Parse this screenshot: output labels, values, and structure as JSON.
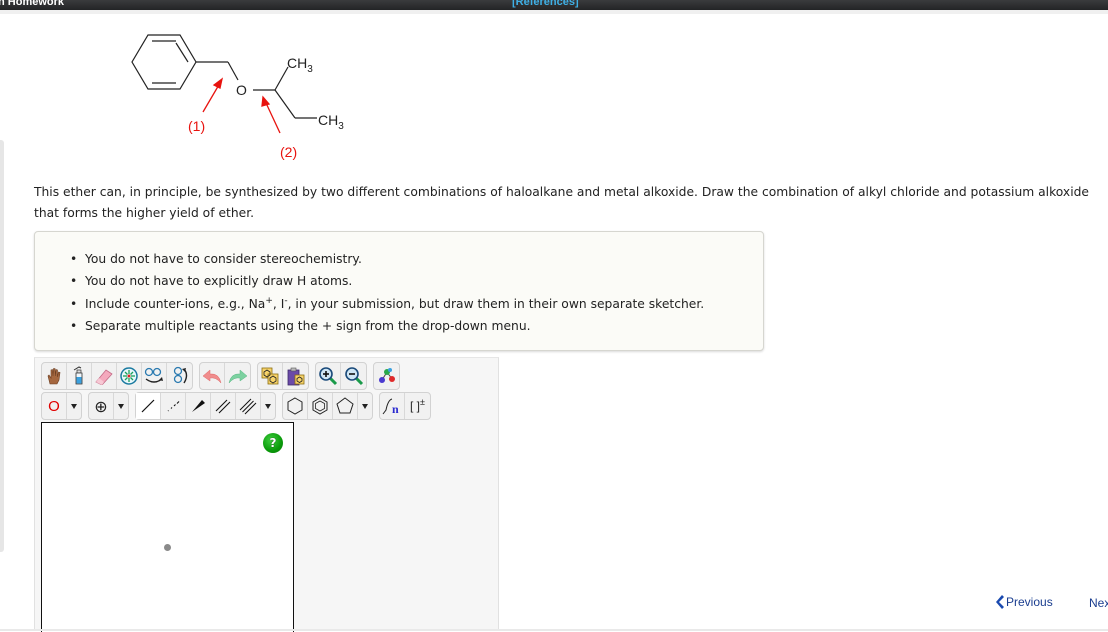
{
  "header": {
    "title": "n Homework",
    "references_link": "[References]"
  },
  "molecule": {
    "name": "benzyl sec-butyl ether",
    "oxygen_label": "O",
    "methyl_top_label": "CH",
    "methyl_bottom_label": "CH",
    "subscript": "3",
    "arrow_label_1": "(1)",
    "arrow_label_2": "(2)",
    "arrow_color": "#e8130f"
  },
  "question": {
    "text": "This ether can, in principle, be synthesized by two different combinations of haloalkane and metal alkoxide. Draw the combination of alkyl chloride and potassium alkoxide that forms the higher yield of ether."
  },
  "notes": {
    "items": [
      "You do not have to consider stereochemistry.",
      "You do not have to explicitly draw H atoms.",
      "Separate multiple reactants using the + sign from the drop-down menu."
    ],
    "counter_ion_item": {
      "prefix": "Include counter-ions, e.g., Na",
      "sup1": "+",
      "mid": ", I",
      "sup2": "-",
      "suffix": ", in your submission, but draw them in their own separate sketcher."
    }
  },
  "sketcher": {
    "toolbar_top": [
      {
        "icon": "hand-icon",
        "tooltip": "Move"
      },
      {
        "icon": "wash-bottle-icon",
        "tooltip": "Clear"
      },
      {
        "icon": "eraser-icon",
        "tooltip": "Erase"
      },
      {
        "icon": "center-icon",
        "tooltip": "Center"
      },
      {
        "icon": "flip-horizontal-icon",
        "tooltip": "Flip horizontal"
      },
      {
        "icon": "flip-vertical-icon",
        "tooltip": "Flip vertical"
      },
      {
        "icon": "undo-icon",
        "tooltip": "Undo"
      },
      {
        "icon": "redo-icon",
        "tooltip": "Redo"
      },
      {
        "icon": "copy-icon",
        "tooltip": "Copy"
      },
      {
        "icon": "paste-icon",
        "tooltip": "Paste"
      },
      {
        "icon": "zoom-in-icon",
        "tooltip": "Zoom in"
      },
      {
        "icon": "zoom-out-icon",
        "tooltip": "Zoom out"
      },
      {
        "icon": "clean-structure-icon",
        "tooltip": "Clean"
      }
    ],
    "atom_selector": "O",
    "atom_color": "#e00000",
    "charge_symbol": "⊕",
    "bond_tools": [
      "single",
      "dashed",
      "wedge",
      "double",
      "triple"
    ],
    "selected_bond": "single",
    "ring_tools": [
      "cyclohexane",
      "benzene",
      "cyclopentane"
    ],
    "sgroup_label": "n",
    "bracket_label": "[ ]",
    "bracket_sup": "±",
    "help_label": "?"
  },
  "navigation": {
    "previous_label": "Previous",
    "next_label": "Next"
  }
}
